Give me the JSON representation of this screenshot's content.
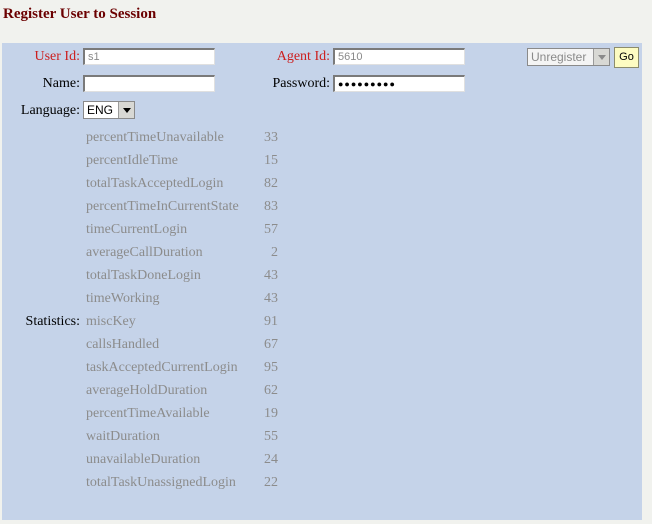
{
  "page": {
    "title": "Register User to Session"
  },
  "form": {
    "user_id_label": "User Id:",
    "user_id_value": "s1",
    "agent_id_label": "Agent Id:",
    "agent_id_value": "5610",
    "name_label": "Name:",
    "name_value": "",
    "password_label": "Password:",
    "password_value": "●●●●●●●●●",
    "language_label": "Language:",
    "language_value": "ENG",
    "action_select_value": "Unregister",
    "go_label": "Go"
  },
  "statistics": {
    "label": "Statistics:",
    "items": [
      {
        "name": "percentTimeUnavailable",
        "value": "33"
      },
      {
        "name": "percentIdleTime",
        "value": "15"
      },
      {
        "name": "totalTaskAcceptedLogin",
        "value": "82"
      },
      {
        "name": "percentTimeInCurrentState",
        "value": "83"
      },
      {
        "name": "timeCurrentLogin",
        "value": "57"
      },
      {
        "name": "averageCallDuration",
        "value": "2"
      },
      {
        "name": "totalTaskDoneLogin",
        "value": "43"
      },
      {
        "name": "timeWorking",
        "value": "43"
      },
      {
        "name": "miscKey",
        "value": "91"
      },
      {
        "name": "callsHandled",
        "value": "67"
      },
      {
        "name": "taskAcceptedCurrentLogin",
        "value": "95"
      },
      {
        "name": "averageHoldDuration",
        "value": "62"
      },
      {
        "name": "percentTimeAvailable",
        "value": "19"
      },
      {
        "name": "waitDuration",
        "value": "55"
      },
      {
        "name": "unavailableDuration",
        "value": "24"
      },
      {
        "name": "totalTaskUnassignedLogin",
        "value": "22"
      }
    ]
  },
  "colors": {
    "title": "#6b0000",
    "panel_background": "#c5d3e9",
    "required_label": "#cc1f1f",
    "statistic_text": "#8c8c8c",
    "go_button": "#fdfcc2"
  }
}
